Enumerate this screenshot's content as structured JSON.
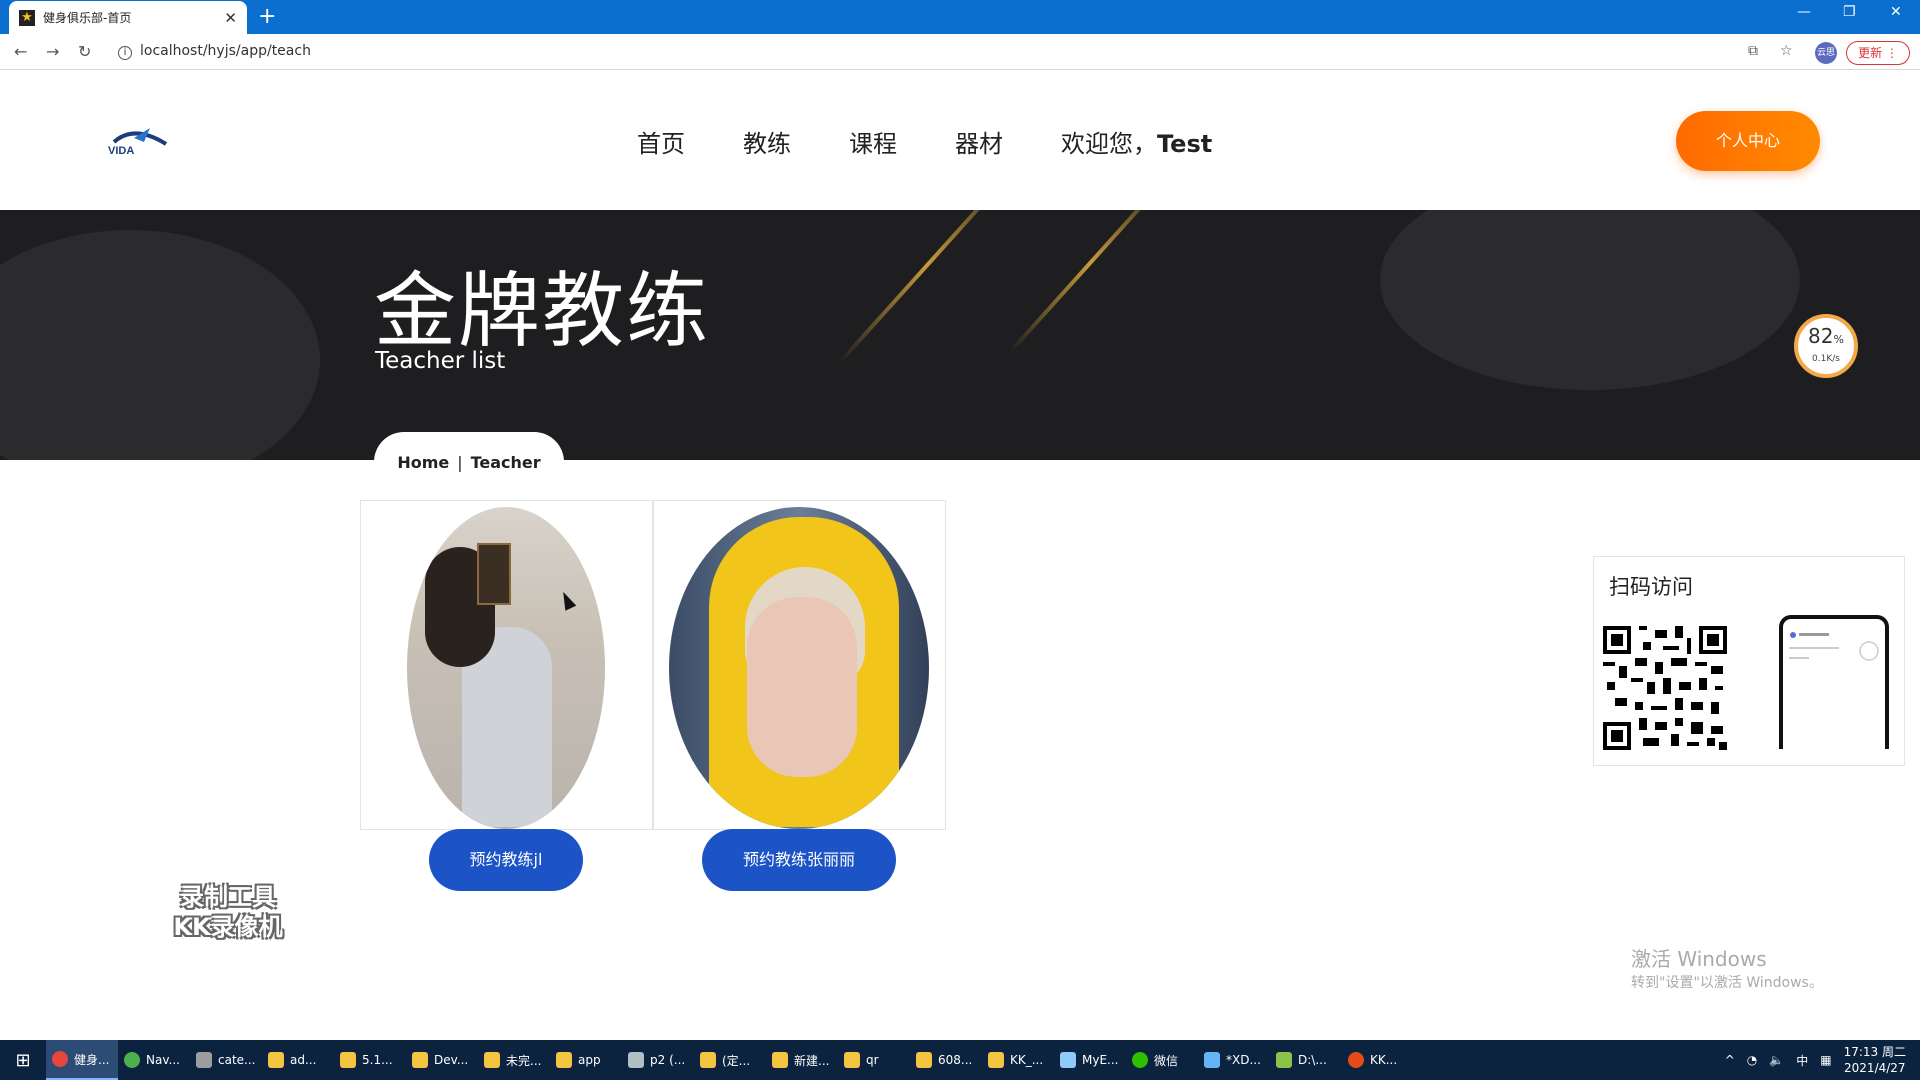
{
  "browser": {
    "tab_title": "健身俱乐部-首页",
    "url": "localhost/hyjs/app/teach",
    "update_label": "更新",
    "profile_initial": "云思"
  },
  "header": {
    "nav": [
      "首页",
      "教练",
      "课程",
      "器材"
    ],
    "welcome_prefix": "欢迎您，",
    "welcome_user": "Test",
    "profile_button": "个人中心",
    "logo_text": "VIDA"
  },
  "banner": {
    "title": "金牌教练",
    "subtitle": "Teacher list",
    "breadcrumb_home": "Home",
    "breadcrumb_sep": "|",
    "breadcrumb_current": "Teacher"
  },
  "teachers": [
    {
      "book_label": "预约教练jl"
    },
    {
      "book_label": "预约教练张丽丽"
    }
  ],
  "qr": {
    "title": "扫码访问"
  },
  "speed_widget": {
    "percent": "82",
    "percent_unit": "%",
    "rate": "0.1K/s"
  },
  "watermark": {
    "line1": "录制工具",
    "line2": "KK录像机"
  },
  "activation": {
    "line1": "激活 Windows",
    "line2": "转到\"设置\"以激活 Windows。"
  },
  "taskbar": {
    "items": [
      "健身...",
      "Nav...",
      "cate...",
      "ad...",
      "5.1...",
      "Dev...",
      "未完...",
      "app",
      "p2 (...",
      "(定...",
      "新建...",
      "qr",
      "608...",
      "KK_...",
      "MyE...",
      "微信",
      "*XD...",
      "D:\\...",
      "KK..."
    ],
    "ime": "中",
    "time": "17:13 周二",
    "date": "2021/4/27"
  },
  "colors": {
    "accent_orange": "#ff7a00",
    "button_blue": "#1c54c8",
    "tab_blue": "#0a6fce"
  }
}
